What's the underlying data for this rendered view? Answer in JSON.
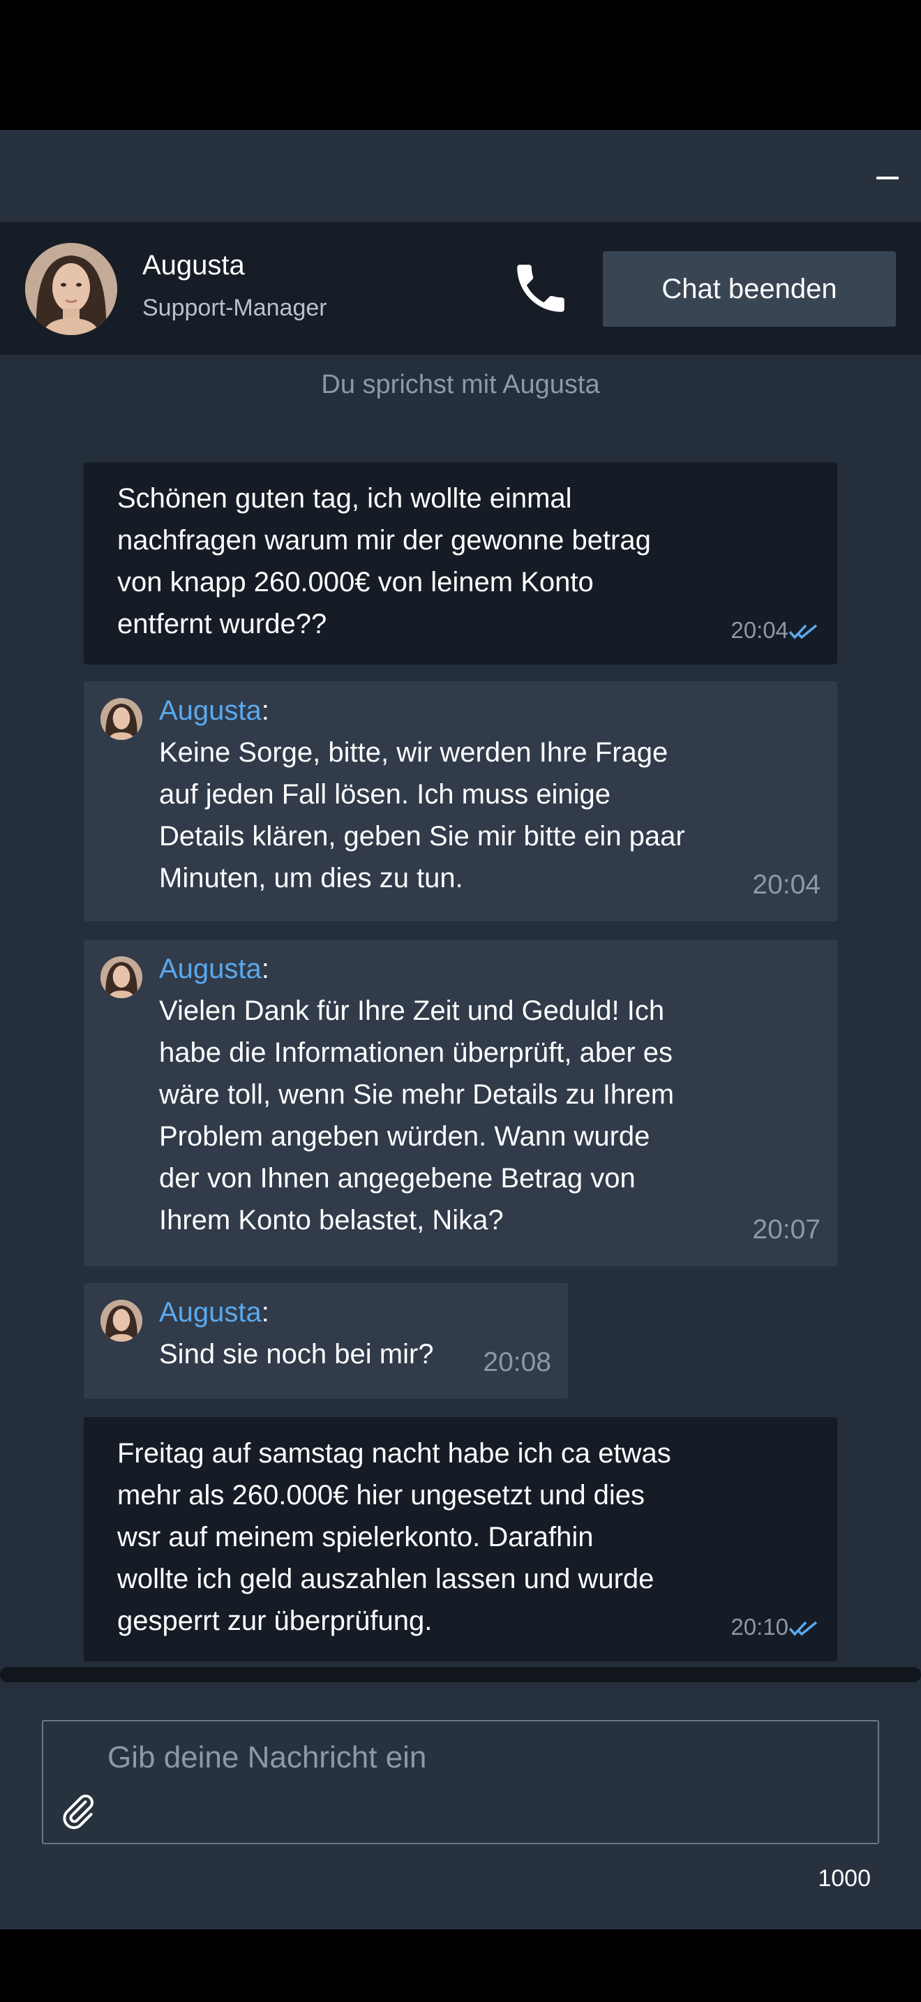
{
  "header": {
    "agent_name": "Augusta",
    "agent_role": "Support-Manager",
    "end_chat_label": "Chat beenden"
  },
  "info_text": "Du sprichst mit Augusta",
  "messages": [
    {
      "from": "user",
      "text": "Schönen guten tag, ich wollte einmal\nnachfragen warum mir der gewonne betrag\nvon knapp 260.000€ von leinem Konto\nentfernt wurde??",
      "time": "20:04",
      "read": true
    },
    {
      "from": "agent",
      "name": "Augusta",
      "text": "Keine Sorge, bitte, wir werden Ihre Frage\nauf jeden Fall lösen. Ich muss einige\nDetails klären, geben Sie mir bitte ein paar\nMinuten, um dies zu tun.",
      "time": "20:04"
    },
    {
      "from": "agent",
      "name": "Augusta",
      "text": "Vielen Dank für Ihre Zeit und Geduld! Ich\nhabe die Informationen überprüft, aber es\nwäre toll, wenn Sie mehr Details zu Ihrem\nProblem angeben würden. Wann wurde\nder von Ihnen angegebene Betrag von\nIhrem Konto belastet, Nika?",
      "time": "20:07"
    },
    {
      "from": "agent",
      "name": "Augusta",
      "text": "Sind sie noch bei mir?",
      "time": "20:08"
    },
    {
      "from": "user",
      "text": "Freitag auf samstag nacht habe ich ca etwas\nmehr als 260.000€ hier ungesetzt und dies\nwsr auf meinem spielerkonto. Darafhin\nwollte ich geld auszahlen lassen und wurde\ngesperrt zur überprüfung.",
      "time": "20:10",
      "read": true
    }
  ],
  "composer": {
    "placeholder": "Gib deine Nachricht ein",
    "value": "",
    "char_limit": "1000"
  },
  "colors": {
    "accent": "#5aa9ee",
    "window_bg": "#252e3b",
    "user_bubble": "#161c25",
    "agent_bubble": "#313b4a"
  },
  "icons": {
    "minimize": "minimize-icon",
    "phone": "phone-icon",
    "read_receipt": "double-check-icon",
    "attach": "paperclip-icon"
  }
}
